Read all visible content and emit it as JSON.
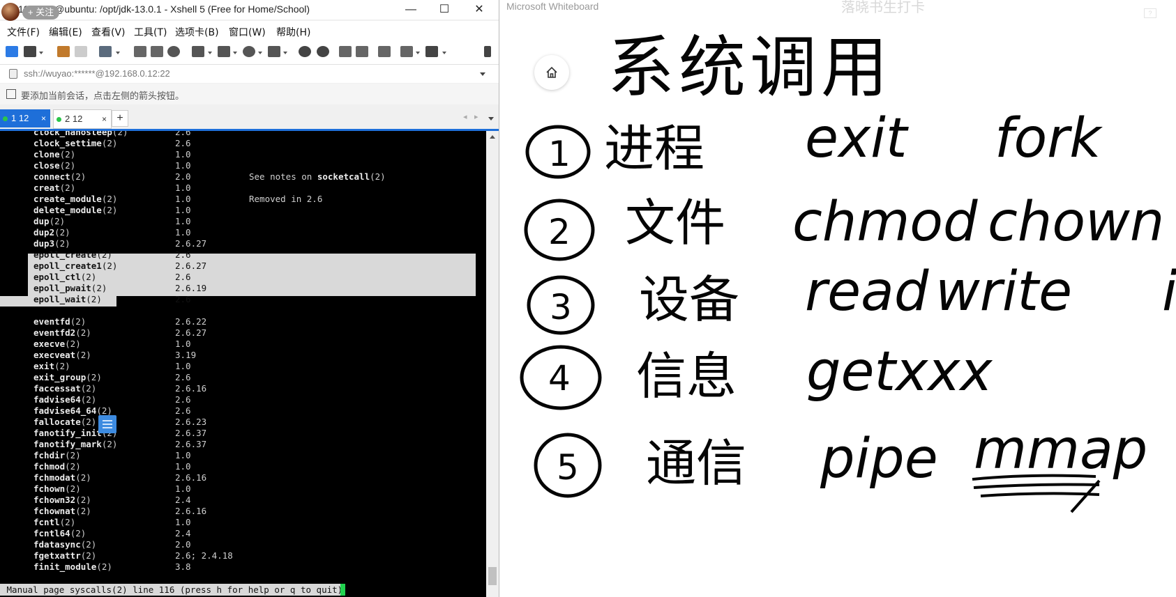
{
  "xshell": {
    "follow_badge": "+ 关注",
    "title": "12 - root@ubuntu: /opt/jdk-13.0.1 - Xshell 5 (Free for Home/School)",
    "window_buttons": {
      "minimize": "—",
      "maximize": "☐",
      "close": "✕"
    },
    "menu": [
      "文件(F)",
      "编辑(E)",
      "查看(V)",
      "工具(T)",
      "选项卡(B)",
      "窗口(W)",
      "帮助(H)"
    ],
    "address": "ssh://wuyao:******@192.168.0.12:22",
    "hint": "要添加当前会话，点击左侧的箭头按钮。",
    "tabs": [
      {
        "label": "1 12",
        "close": "×"
      },
      {
        "label": "2 12",
        "close": "×"
      }
    ],
    "add_tab": "+",
    "tab_nav": {
      "prev": "◂",
      "next": "▸"
    },
    "terminal": {
      "rows": [
        {
          "name": "clock_nanosleep",
          "sect": "(2)",
          "ver": "2.6",
          "note": ""
        },
        {
          "name": "clock_settime",
          "sect": "(2)",
          "ver": "2.6",
          "note": ""
        },
        {
          "name": "clone",
          "sect": "(2)",
          "ver": "1.0",
          "note": ""
        },
        {
          "name": "close",
          "sect": "(2)",
          "ver": "1.0",
          "note": ""
        },
        {
          "name": "connect",
          "sect": "(2)",
          "ver": "2.0",
          "note": "See notes on",
          "note_bold": "socketcall",
          "note_tail": "(2)"
        },
        {
          "name": "creat",
          "sect": "(2)",
          "ver": "1.0",
          "note": ""
        },
        {
          "name": "create_module",
          "sect": "(2)",
          "ver": "1.0",
          "note": "Removed in 2.6"
        },
        {
          "name": "delete_module",
          "sect": "(2)",
          "ver": "1.0",
          "note": ""
        },
        {
          "name": "dup",
          "sect": "(2)",
          "ver": "1.0",
          "note": ""
        },
        {
          "name": "dup2",
          "sect": "(2)",
          "ver": "1.0",
          "note": ""
        },
        {
          "name": "dup3",
          "sect": "(2)",
          "ver": "2.6.27",
          "note": ""
        },
        {
          "name": "epoll_create",
          "sect": "(2)",
          "ver": "2.6",
          "note": "",
          "selected": true
        },
        {
          "name": "epoll_create1",
          "sect": "(2)",
          "ver": "2.6.27",
          "note": "",
          "selected": true
        },
        {
          "name": "epoll_ctl",
          "sect": "(2)",
          "ver": "2.6",
          "note": "",
          "selected": true
        },
        {
          "name": "epoll_pwait",
          "sect": "(2)",
          "ver": "2.6.19",
          "note": "",
          "selected": true
        },
        {
          "name": "epoll_wait",
          "sect": "(2)",
          "ver": "2.6",
          "note": "",
          "selected": true
        },
        {
          "name": "",
          "sect": "",
          "ver": "",
          "note": ""
        },
        {
          "name": "eventfd",
          "sect": "(2)",
          "ver": "2.6.22",
          "note": ""
        },
        {
          "name": "eventfd2",
          "sect": "(2)",
          "ver": "2.6.27",
          "note": ""
        },
        {
          "name": "execve",
          "sect": "(2)",
          "ver": "1.0",
          "note": ""
        },
        {
          "name": "execveat",
          "sect": "(2)",
          "ver": "3.19",
          "note": ""
        },
        {
          "name": "exit",
          "sect": "(2)",
          "ver": "1.0",
          "note": ""
        },
        {
          "name": "exit_group",
          "sect": "(2)",
          "ver": "2.6",
          "note": ""
        },
        {
          "name": "faccessat",
          "sect": "(2)",
          "ver": "2.6.16",
          "note": ""
        },
        {
          "name": "fadvise64",
          "sect": "(2)",
          "ver": "2.6",
          "note": ""
        },
        {
          "name": "fadvise64_64",
          "sect": "(2)",
          "ver": "2.6",
          "note": ""
        },
        {
          "name": "fallocate",
          "sect": "(2)",
          "ver": "2.6.23",
          "note": ""
        },
        {
          "name": "fanotify_init",
          "sect": "(2)",
          "ver": "2.6.37",
          "note": ""
        },
        {
          "name": "fanotify_mark",
          "sect": "(2)",
          "ver": "2.6.37",
          "note": ""
        },
        {
          "name": "fchdir",
          "sect": "(2)",
          "ver": "1.0",
          "note": ""
        },
        {
          "name": "fchmod",
          "sect": "(2)",
          "ver": "1.0",
          "note": ""
        },
        {
          "name": "fchmodat",
          "sect": "(2)",
          "ver": "2.6.16",
          "note": ""
        },
        {
          "name": "fchown",
          "sect": "(2)",
          "ver": "1.0",
          "note": ""
        },
        {
          "name": "fchown32",
          "sect": "(2)",
          "ver": "2.4",
          "note": ""
        },
        {
          "name": "fchownat",
          "sect": "(2)",
          "ver": "2.6.16",
          "note": ""
        },
        {
          "name": "fcntl",
          "sect": "(2)",
          "ver": "1.0",
          "note": ""
        },
        {
          "name": "fcntl64",
          "sect": "(2)",
          "ver": "2.4",
          "note": ""
        },
        {
          "name": "fdatasync",
          "sect": "(2)",
          "ver": "2.0",
          "note": ""
        },
        {
          "name": "fgetxattr",
          "sect": "(2)",
          "ver": "2.6; 2.4.18",
          "note": ""
        },
        {
          "name": "finit_module",
          "sect": "(2)",
          "ver": "3.8",
          "note": ""
        }
      ],
      "status": " Manual page syscalls(2) line 116 (press h for help or q to quit)"
    }
  },
  "whiteboard": {
    "app_title": "Microsoft Whiteboard",
    "streamer": "落晓书生打卡",
    "corner": "?",
    "heading": "系统调用",
    "items": [
      {
        "num": "1",
        "cn": "进程",
        "terms": [
          "exit",
          "fork"
        ]
      },
      {
        "num": "2",
        "cn": "文件",
        "terms": [
          "chmod",
          "chown"
        ]
      },
      {
        "num": "3",
        "cn": "设备",
        "terms": [
          "read",
          "write",
          "i"
        ]
      },
      {
        "num": "4",
        "cn": "信息",
        "terms": [
          "getxxx"
        ]
      },
      {
        "num": "5",
        "cn": "通信",
        "terms": [
          "pipe",
          "mmap"
        ]
      }
    ]
  }
}
